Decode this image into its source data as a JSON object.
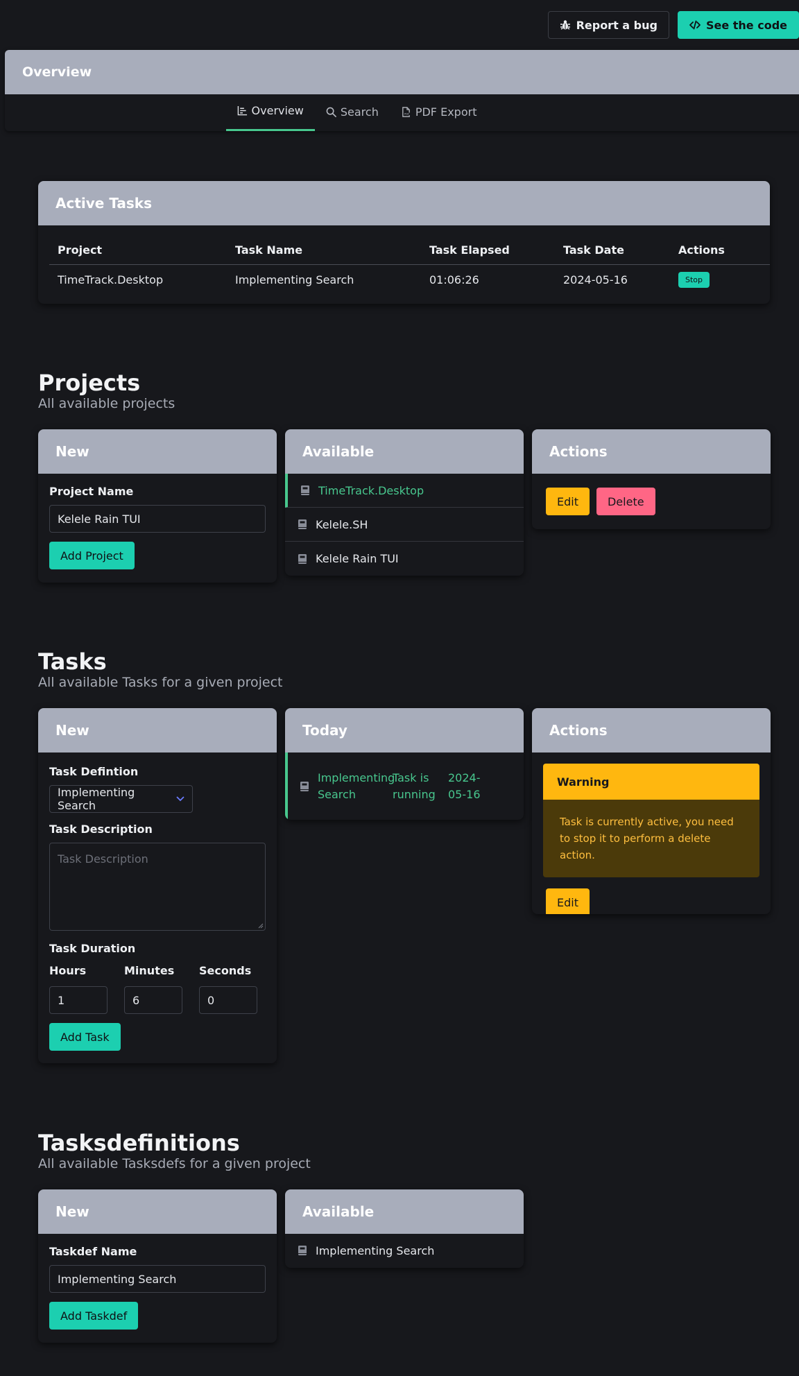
{
  "header": {
    "report_bug_label": "Report a bug",
    "see_code_label": "See the code"
  },
  "overview": {
    "title": "Overview",
    "tabs": [
      {
        "label": "Overview",
        "active": true,
        "icon": "chart-icon"
      },
      {
        "label": "Search",
        "active": false,
        "icon": "search-icon"
      },
      {
        "label": "PDF Export",
        "active": false,
        "icon": "pdf-icon"
      }
    ]
  },
  "active_tasks": {
    "title": "Active Tasks",
    "columns": [
      "Project",
      "Task Name",
      "Task Elapsed",
      "Task Date",
      "Actions"
    ],
    "rows": [
      {
        "project": "TimeTrack.Desktop",
        "task_name": "Implementing Search",
        "elapsed": "01:06:26",
        "date": "2024-05-16",
        "action_label": "Stop"
      }
    ]
  },
  "projects": {
    "title": "Projects",
    "subtitle": "All available projects",
    "new": {
      "title": "New",
      "field_label": "Project Name",
      "field_value": "Kelele Rain TUI",
      "button_label": "Add Project"
    },
    "available": {
      "title": "Available",
      "items": [
        "TimeTrack.Desktop",
        "Kelele.SH",
        "Kelele Rain TUI"
      ],
      "selected_index": 0
    },
    "actions": {
      "title": "Actions",
      "edit_label": "Edit",
      "delete_label": "Delete"
    }
  },
  "tasks": {
    "title": "Tasks",
    "subtitle": "All available Tasks for a given project",
    "new": {
      "title": "New",
      "definition_label": "Task Defintion",
      "definition_value": "Implementing Search",
      "description_label": "Task Description",
      "description_placeholder": "Task Description",
      "duration_label": "Task Duration",
      "hours_label": "Hours",
      "hours_value": "1",
      "minutes_label": "Minutes",
      "minutes_value": "6",
      "seconds_label": "Seconds",
      "seconds_value": "0",
      "button_label": "Add Task"
    },
    "today": {
      "title": "Today",
      "item_name": "Implementing Search",
      "item_status": "Task is running",
      "item_date": "2024-05-16"
    },
    "actions": {
      "title": "Actions",
      "warning_title": "Warning",
      "warning_text": "Task is currently active, you need to stop it to perform a delete action.",
      "edit_label": "Edit"
    }
  },
  "taskdefs": {
    "title": "Tasksdefinitions",
    "subtitle": "All available Tasksdefs for a given project",
    "new": {
      "title": "New",
      "field_label": "Taskdef Name",
      "field_value": "Implementing Search",
      "button_label": "Add Taskdef"
    },
    "available": {
      "title": "Available",
      "items": [
        "Implementing Search"
      ]
    }
  },
  "colors": {
    "accent": "#1ccfb0",
    "success": "#48c78e",
    "warning": "#ffb70f",
    "danger": "#ff6685",
    "card_header": "#a8adbb",
    "background": "#17181c"
  }
}
